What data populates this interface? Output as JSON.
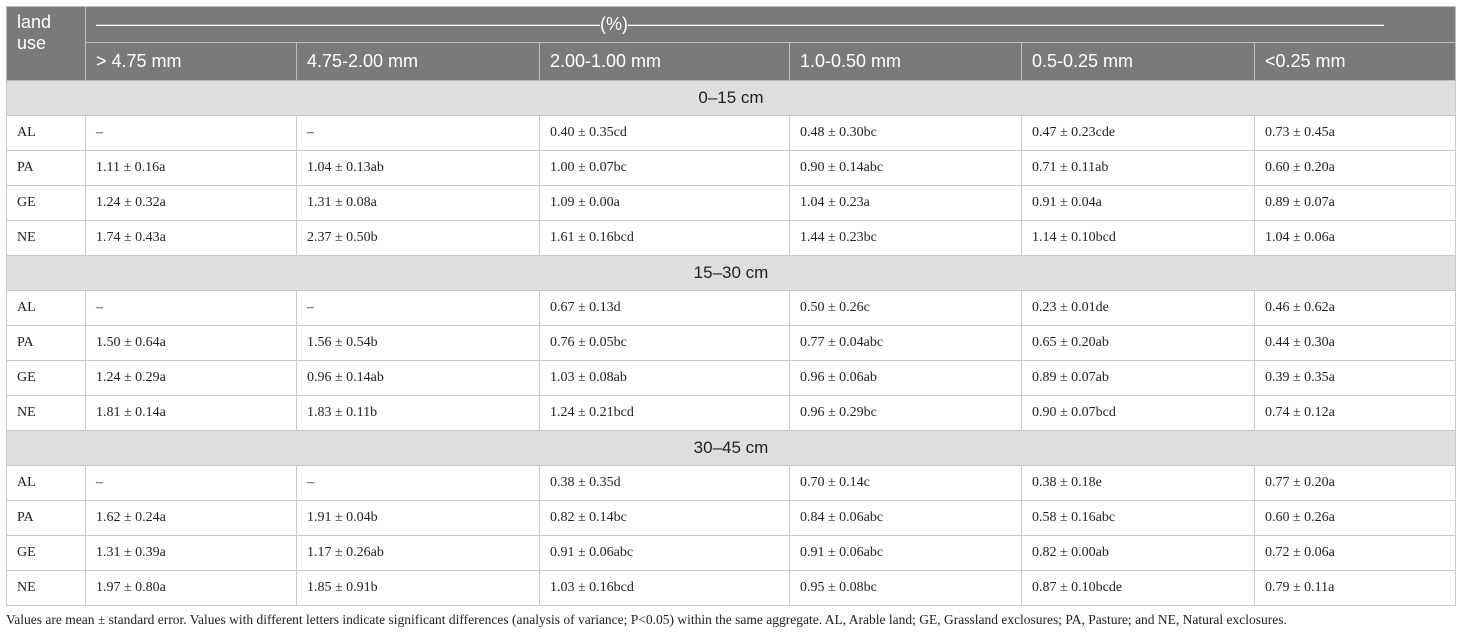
{
  "table": {
    "land_use_header": "land use",
    "percent_header": "————————————————————————————(%)——————————————————————————————————————————",
    "size_classes": [
      "> 4.75 mm",
      "4.75-2.00 mm",
      "2.00-1.00 mm",
      "1.0-0.50 mm",
      "0.5-0.25 mm",
      "<0.25 mm"
    ],
    "sections": [
      {
        "depth": "0–15 cm",
        "rows": [
          {
            "land": "AL",
            "values": [
              "–",
              "–",
              "0.40 ± 0.35cd",
              "0.48 ± 0.30bc",
              "0.47 ± 0.23cde",
              "0.73 ± 0.45a"
            ]
          },
          {
            "land": "PA",
            "values": [
              "1.11 ± 0.16a",
              "1.04 ± 0.13ab",
              "1.00 ± 0.07bc",
              "0.90 ± 0.14abc",
              "0.71 ± 0.11ab",
              "0.60 ± 0.20a"
            ]
          },
          {
            "land": "GE",
            "values": [
              "1.24 ± 0.32a",
              "1.31 ± 0.08a",
              "1.09 ± 0.00a",
              "1.04 ± 0.23a",
              "0.91 ± 0.04a",
              "0.89 ± 0.07a"
            ]
          },
          {
            "land": "NE",
            "values": [
              "1.74 ± 0.43a",
              "2.37 ± 0.50b",
              "1.61 ± 0.16bcd",
              "1.44 ± 0.23bc",
              "1.14 ± 0.10bcd",
              "1.04 ± 0.06a"
            ]
          }
        ]
      },
      {
        "depth": "15–30 cm",
        "rows": [
          {
            "land": "AL",
            "values": [
              "–",
              "–",
              "0.67 ± 0.13d",
              "0.50 ± 0.26c",
              "0.23 ± 0.01de",
              "0.46 ± 0.62a"
            ]
          },
          {
            "land": "PA",
            "values": [
              "1.50 ± 0.64a",
              "1.56 ± 0.54b",
              "0.76 ± 0.05bc",
              "0.77 ± 0.04abc",
              "0.65 ± 0.20ab",
              "0.44 ± 0.30a"
            ]
          },
          {
            "land": "GE",
            "values": [
              "1.24 ± 0.29a",
              "0.96 ± 0.14ab",
              "1.03 ± 0.08ab",
              "0.96 ± 0.06ab",
              "0.89 ± 0.07ab",
              "0.39 ± 0.35a"
            ]
          },
          {
            "land": "NE",
            "values": [
              "1.81 ± 0.14a",
              "1.83 ± 0.11b",
              "1.24 ± 0.21bcd",
              "0.96 ± 0.29bc",
              "0.90 ± 0.07bcd",
              "0.74 ± 0.12a"
            ]
          }
        ]
      },
      {
        "depth": "30–45 cm",
        "rows": [
          {
            "land": "AL",
            "values": [
              "–",
              "–",
              "0.38 ± 0.35d",
              "0.70 ± 0.14c",
              "0.38 ± 0.18e",
              "0.77 ± 0.20a"
            ]
          },
          {
            "land": "PA",
            "values": [
              "1.62 ± 0.24a",
              "1.91 ± 0.04b",
              "0.82 ± 0.14bc",
              "0.84 ± 0.06abc",
              "0.58 ± 0.16abc",
              "0.60 ± 0.26a"
            ]
          },
          {
            "land": "GE",
            "values": [
              "1.31 ± 0.39a",
              "1.17 ± 0.26ab",
              "0.91 ± 0.06abc",
              "0.91 ± 0.06abc",
              "0.82 ± 0.00ab",
              "0.72 ± 0.06a"
            ]
          },
          {
            "land": "NE",
            "values": [
              "1.97 ± 0.80a",
              "1.85 ± 0.91b",
              "1.03 ± 0.16bcd",
              "0.95 ± 0.08bc",
              "0.87 ± 0.10bcde",
              "0.79 ± 0.11a"
            ]
          }
        ]
      }
    ]
  },
  "footnote": "Values are mean ± standard error. Values with different letters indicate significant differences (analysis of variance; P<0.05) within the same aggregate. AL, Arable land; GE, Grassland exclosures; PA, Pasture; and NE, Natural exclosures."
}
